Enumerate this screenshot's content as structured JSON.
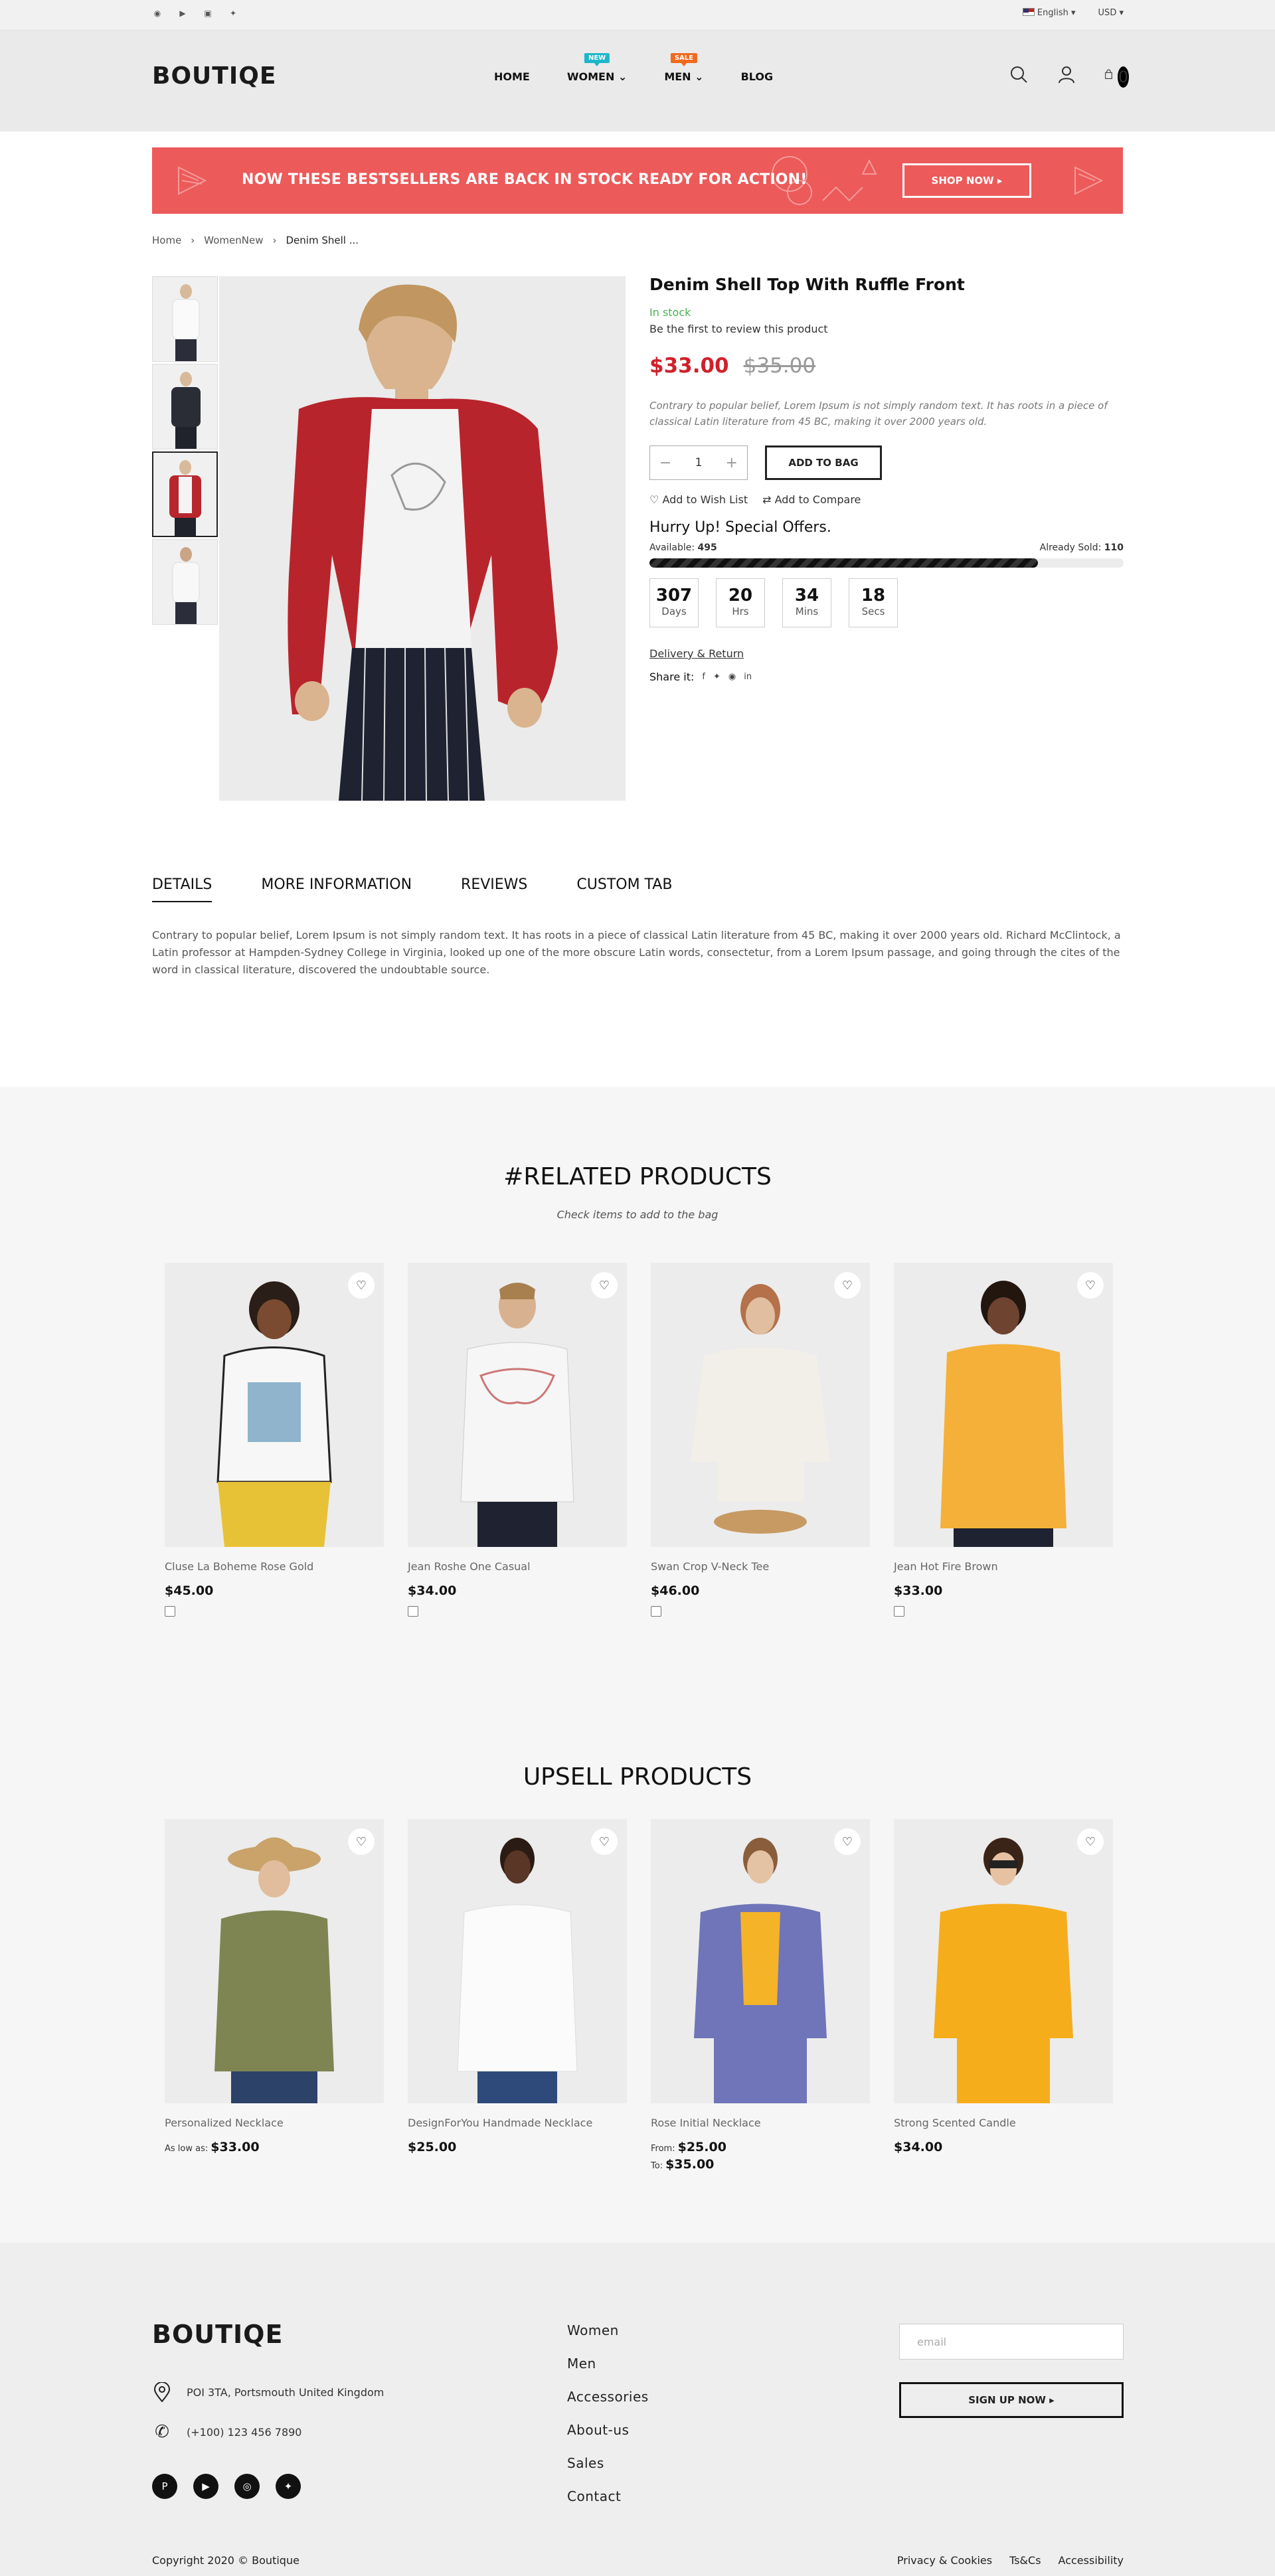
{
  "topbar": {
    "socials": [
      "pinterest-icon",
      "youtube-icon",
      "instagram-icon",
      "twitter-icon"
    ],
    "language": "English",
    "currency": "USD"
  },
  "header": {
    "logo": "BOUTIQE",
    "nav": [
      {
        "label": "HOME",
        "badge": ""
      },
      {
        "label": "WOMEN",
        "badge": "NEW"
      },
      {
        "label": "MEN",
        "badge": "SALE"
      },
      {
        "label": "BLOG",
        "badge": ""
      }
    ],
    "cart_count": "0"
  },
  "banner": {
    "text": "NOW THESE BESTSELLERS ARE BACK IN STOCK READY FOR ACTION!",
    "button": "SHOP NOW"
  },
  "breadcrumb": [
    "Home",
    "WomenNew",
    "Denim Shell ..."
  ],
  "product": {
    "title": "Denim Shell Top With Ruffle Front",
    "stock": "In stock",
    "review": "Be the first to review this product",
    "price": "$33.00",
    "old_price": "$35.00",
    "description": "Contrary to popular belief, Lorem Ipsum is not simply random text. It has roots in a piece of classical Latin literature from 45 BC, making it over 2000 years old.",
    "qty": "1",
    "add_to_bag": "ADD TO BAG",
    "wishlist": "Add to Wish List",
    "compare": "Add to Compare",
    "hurry": "Hurry Up! Special Offers.",
    "available_label": "Available:",
    "available": "495",
    "sold_label": "Already Sold:",
    "sold": "110",
    "sold_fraction": 0.82,
    "countdown": [
      {
        "n": "307",
        "l": "Days"
      },
      {
        "n": "20",
        "l": "Hrs"
      },
      {
        "n": "34",
        "l": "Mins"
      },
      {
        "n": "18",
        "l": "Secs"
      }
    ],
    "delivery": "Delivery & Return",
    "share": "Share it:"
  },
  "tabs": [
    "DETAILS",
    "MORE INFORMATION",
    "REVIEWS",
    "CUSTOM TAB"
  ],
  "details_text": "Contrary to popular belief, Lorem Ipsum is not simply random text. It has roots in a piece of classical Latin literature from 45 BC, making it over 2000 years old. Richard McClintock, a Latin professor at Hampden-Sydney College in Virginia, looked up one of the more obscure Latin words, consectetur, from a Lorem Ipsum passage, and going through the cites of the word in classical literature, discovered the undoubtable source.",
  "related": {
    "title": "#RELATED PRODUCTS",
    "subtitle": "Check items to add to the bag",
    "items": [
      {
        "name": "Cluse La Boheme Rose Gold",
        "price": "$45.00"
      },
      {
        "name": "Jean Roshe One Casual",
        "price": "$34.00"
      },
      {
        "name": "Swan Crop V-Neck Tee",
        "price": "$46.00"
      },
      {
        "name": "Jean Hot Fire Brown",
        "price": "$33.00"
      }
    ]
  },
  "upsell": {
    "title": "UPSELL PRODUCTS",
    "items": [
      {
        "name": "Personalized Necklace",
        "prefix": "As low as:",
        "price": "$33.00",
        "prefix2": "",
        "price2": ""
      },
      {
        "name": "DesignForYou Handmade Necklace",
        "prefix": "",
        "price": "$25.00",
        "prefix2": "",
        "price2": ""
      },
      {
        "name": "Rose Initial Necklace",
        "prefix": "From:",
        "price": "$25.00",
        "prefix2": "To:",
        "price2": "$35.00"
      },
      {
        "name": "Strong Scented Candle",
        "prefix": "",
        "price": "$34.00",
        "prefix2": "",
        "price2": ""
      }
    ]
  },
  "footer": {
    "logo": "BOUTIQE",
    "address": "POI 3TA, Portsmouth United Kingdom",
    "phone": "(+100) 123 456 7890",
    "links": [
      "Women",
      "Men",
      "Accessories",
      "About-us",
      "Sales",
      "Contact"
    ],
    "email_placeholder": "email",
    "signup": "SIGN UP NOW",
    "copyright": "Copyright 2020 © Boutique",
    "legal": [
      "Privacy & Cookies",
      "Ts&Cs",
      "Accessibility"
    ]
  }
}
